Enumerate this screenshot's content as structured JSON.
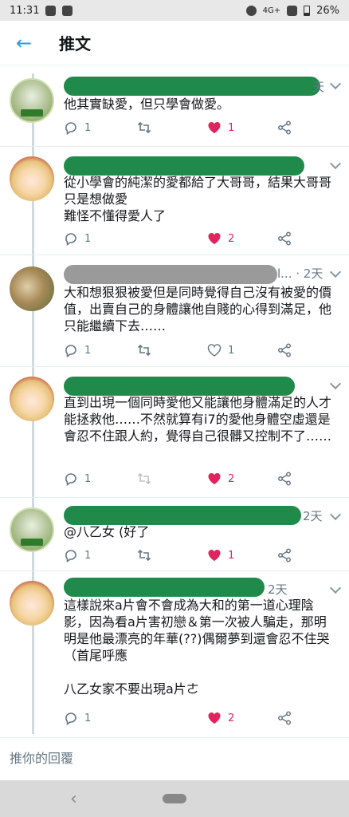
{
  "status_bar": {
    "time": "11:31",
    "network": "4G+",
    "battery": "26%"
  },
  "header": {
    "title": "推文"
  },
  "tweets": [
    {
      "time": "天",
      "text": "他其實缺愛，但只學會做愛。",
      "replies": "1",
      "likes": "1"
    },
    {
      "time": "",
      "text": "從小學會的純潔的愛都給了大哥哥，結果大哥哥只是想做愛\n難怪不懂得愛人了",
      "replies": "1",
      "likes": "2"
    },
    {
      "time": "l... · 2天",
      "text": "大和想狠狠被愛但是同時覺得自己沒有被愛的價值，出賣自己的身體讓他自賤的心得到滿足，他只能繼續下去……",
      "replies": "1",
      "likes": "1"
    },
    {
      "time": "",
      "text": "直到出現一個同時愛他又能讓他身體滿足的人才能拯救他……不然就算有i7的愛他身體空虛還是會忍不住跟人約，覺得自己很髒又控制不了……",
      "replies": "1",
      "likes": "2"
    },
    {
      "time": "2天",
      "text": "@八乙女 (好了",
      "replies": "1",
      "likes": "1"
    },
    {
      "time": "2天",
      "text": "這樣說來a片會不會成為大和的第一道心理陰影，因為看a片害初戀＆第一次被人騙走，那明明是他最漂亮的年華(??)偶爾夢到還會忍不住哭（首尾呼應\n\n八乙女家不要出現a片ㄜ",
      "replies": "1",
      "likes": "2"
    }
  ],
  "reply_bar": {
    "placeholder": "推你的回覆"
  },
  "colors": {
    "accent": "#1da1f2",
    "like": "#e0245e",
    "muted": "#657786"
  }
}
